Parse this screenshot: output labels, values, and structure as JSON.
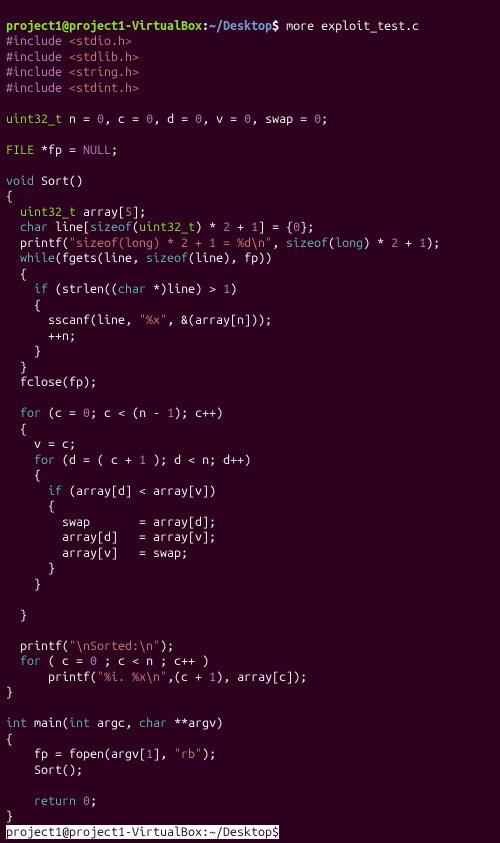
{
  "prompt": {
    "user": "project1@project1-VirtualBox",
    "sep1": ":",
    "path": "~/Desktop",
    "sep2": "$ ",
    "cmd": "more exploit_test.c"
  },
  "code": {
    "inc1a": "#include ",
    "inc1b": "<stdio.h>",
    "inc2a": "#include ",
    "inc2b": "<stdlib.h>",
    "inc3a": "#include ",
    "inc3b": "<string.h>",
    "inc4a": "#include ",
    "inc4b": "<stdint.h>",
    "gv1_type": "uint32_t",
    "gv1_rest": " n = ",
    "gv1_z0": "0",
    "gv1_r1": ", c = ",
    "gv1_z1": "0",
    "gv1_r2": ", d = ",
    "gv1_z2": "0",
    "gv1_r3": ", v = ",
    "gv1_z3": "0",
    "gv1_r4": ", swap = ",
    "gv1_z4": "0",
    "gv1_r5": ";",
    "fp_kw": "FILE",
    "fp_rest": " *fp = ",
    "fp_null": "NULL",
    "fp_end": ";",
    "fn_kw": "void",
    "fn_name": " Sort()",
    "brace_o": "{",
    "l_arr_t": "uint32_t",
    "l_arr_r": " array[",
    "l_arr_n": "5",
    "l_arr_e": "];",
    "l_ln_t": "char",
    "l_ln_r": " line[",
    "l_ln_kw": "sizeof",
    "l_ln_r2": "(",
    "l_ln_t2": "uint32_t",
    "l_ln_r3": ") * ",
    "l_ln_n2": "2",
    "l_ln_r4": " + ",
    "l_ln_n1": "1",
    "l_ln_r5": "] = {",
    "l_ln_z": "0",
    "l_ln_r6": "};",
    "pf1": "  printf(",
    "pf1_s": "\"sizeof(long) * 2 + 1 = %d\\n\"",
    "pf1_m": ", ",
    "pf1_kw": "sizeof",
    "pf1_r": "(",
    "pf1_t": "long",
    "pf1_r2": ") * ",
    "pf1_n2": "2",
    "pf1_r3": " + ",
    "pf1_n1": "1",
    "pf1_e": ");",
    "wh_kw": "while",
    "wh_r": "(fgets(line, ",
    "wh_kw2": "sizeof",
    "wh_r2": "(line), fp))",
    "bo2": "  {",
    "if1_kw": "if",
    "if1_r": " (strlen((",
    "if1_t": "char",
    "if1_r2": " *)line) > ",
    "if1_n": "1",
    "if1_e": ")",
    "bo3": "    {",
    "ss": "      sscanf(line, ",
    "ss_s": "\"%x\"",
    "ss_r": ", &(array[n]));",
    "pn": "      ++n;",
    "bc3": "    }",
    "bc2": "  }",
    "fc": "  fclose(fp);",
    "for1_kw": "for",
    "for1_r": " (c = ",
    "for1_z": "0",
    "for1_r2": "; c < (n - ",
    "for1_n": "1",
    "for1_r3": "); c++)",
    "bo4": "  {",
    "vc": "    v = c;",
    "for2_kw": "for",
    "for2_r": " (d = ( c + ",
    "for2_n": "1",
    "for2_r2": " ); d < n; d++)",
    "bo5": "    {",
    "if2_kw": "if",
    "if2_r": " (array[d] < array[v])",
    "bo6": "      {",
    "sw1": "        swap       = array[d];",
    "sw2": "        array[d]   = array[v];",
    "sw3": "        array[v]   = swap;",
    "bc6": "      }",
    "bc5": "    }",
    "bc4": "  }",
    "pf2": "  printf(",
    "pf2_s": "\"\\nSorted:\\n\"",
    "pf2_e": ");",
    "for3_kw": "for",
    "for3_r": " ( c = ",
    "for3_z": "0",
    "for3_r2": " ; c < n ; c++ )",
    "pf3": "      printf(",
    "pf3_s": "\"%i. %x\\n\"",
    "pf3_r": ",(c + ",
    "pf3_n": "1",
    "pf3_r2": "), array[c]);",
    "bcF": "}",
    "mn_t": "int",
    "mn_r": " main(",
    "mn_t2": "int",
    "mn_r2": " argc, ",
    "mn_t3": "char",
    "mn_r3": " **argv)",
    "boM": "{",
    "fop": "    fp = fopen(argv[",
    "fop_n": "1",
    "fop_r": "], ",
    "fop_s": "\"rb\"",
    "fop_e": ");",
    "srt": "    Sort();",
    "ret_kw": "return",
    "ret_r": " ",
    "ret_n": "0",
    "ret_e": ";",
    "bcM": "}"
  },
  "bottom": {
    "user": "project1@project1-VirtualBox",
    "sep1": ":",
    "path": "~/Desktop",
    "sep2": "$"
  }
}
